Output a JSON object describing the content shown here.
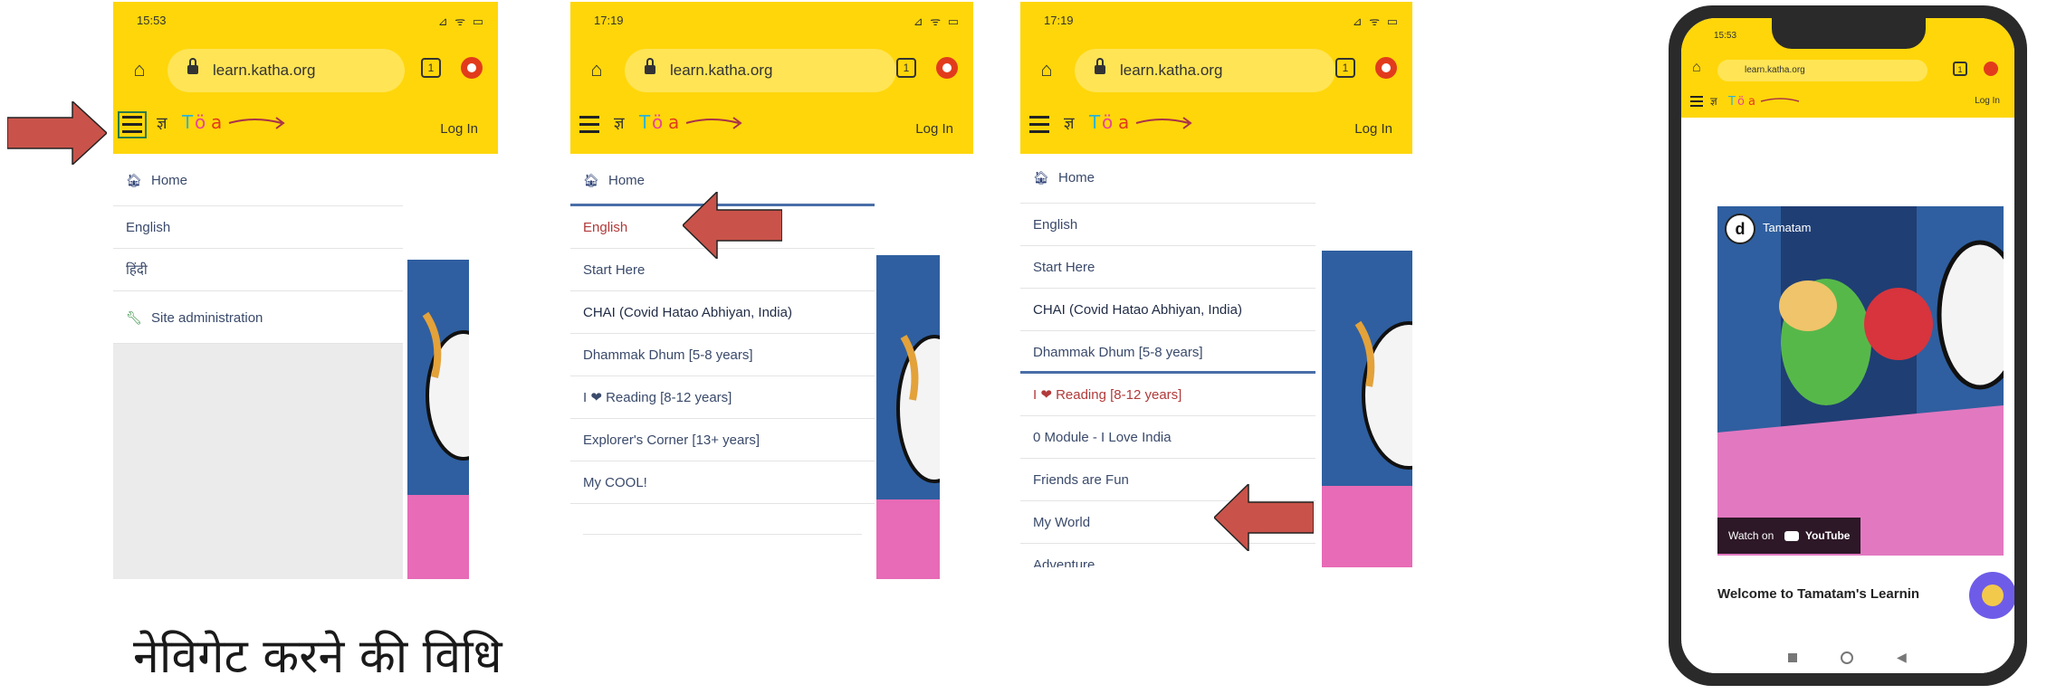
{
  "caption": "नेविगेट करने की विधि",
  "screens": [
    {
      "status_time": "15:53",
      "status_icons": "⊿ ᯤ ▭",
      "url": "learn.katha.org",
      "tabs_count": "1",
      "login": "Log In",
      "menu": [
        "Home",
        "English",
        "हिंदी",
        "Site administration"
      ]
    },
    {
      "status_time": "17:19",
      "status_icons": "⊿ ᯤ ▭",
      "url": "learn.katha.org",
      "tabs_count": "1",
      "login": "Log In",
      "menu": [
        "Home",
        "English",
        "Start Here",
        "CHAI (Covid Hatao Abhiyan, India)",
        "Dhammak Dhum [5-8 years]",
        "I ❤ Reading [8-12 years]",
        "Explorer's Corner [13+ years]",
        "My COOL!"
      ]
    },
    {
      "status_time": "17:19",
      "status_icons": "⊿ ᯤ ▭",
      "url": "learn.katha.org",
      "tabs_count": "1",
      "login": "Log In",
      "menu": [
        "Home",
        "English",
        "Start Here",
        "CHAI (Covid Hatao Abhiyan, India)",
        "Dhammak Dhum [5-8 years]",
        "I ❤ Reading [8-12 years]",
        "0 Module - I Love India",
        "Friends are Fun",
        "My World",
        "Adventure"
      ]
    }
  ],
  "device": {
    "status_time": "15:53",
    "url": "learn.katha.org",
    "tabs_count": "1",
    "login": "Log In",
    "video_channel": "Tamatam",
    "watch_on": "Watch on",
    "youtube": "YouTube",
    "welcome": "Welcome to Tamatam's Learnin"
  },
  "colors": {
    "brand_yellow": "#ffd60a",
    "arrow": "#c9534a",
    "menu_text": "#3a4a6b",
    "active_red": "#b23a3a"
  }
}
